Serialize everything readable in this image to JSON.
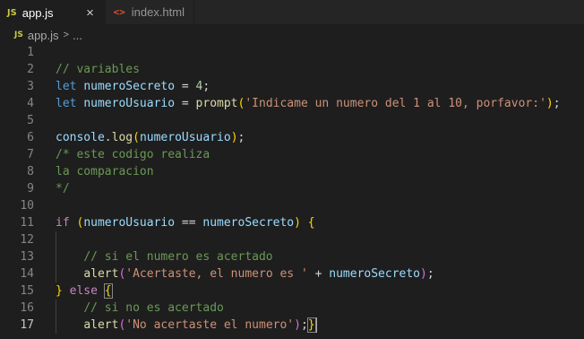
{
  "tabs": [
    {
      "icon": "JS",
      "label": "app.js",
      "active": true,
      "close": "×"
    },
    {
      "icon": "<>",
      "label": "index.html",
      "active": false
    }
  ],
  "breadcrumb": {
    "icon": "JS",
    "file": "app.js",
    "separator": ">",
    "more": "..."
  },
  "editor": {
    "current_line": 17,
    "line_numbers": [
      "1",
      "2",
      "3",
      "4",
      "5",
      "6",
      "7",
      "8",
      "9",
      "10",
      "11",
      "12",
      "13",
      "14",
      "15",
      "16",
      "17"
    ],
    "lines": [
      {
        "tokens": []
      },
      {
        "tokens": [
          {
            "t": "// variables",
            "c": "cm"
          }
        ]
      },
      {
        "tokens": [
          {
            "t": "let",
            "c": "kw"
          },
          {
            "t": " ",
            "c": "op"
          },
          {
            "t": "numeroSecreto",
            "c": "var"
          },
          {
            "t": " = ",
            "c": "op"
          },
          {
            "t": "4",
            "c": "num"
          },
          {
            "t": ";",
            "c": "op"
          }
        ]
      },
      {
        "tokens": [
          {
            "t": "let",
            "c": "kw"
          },
          {
            "t": " ",
            "c": "op"
          },
          {
            "t": "numeroUsuario",
            "c": "var"
          },
          {
            "t": " = ",
            "c": "op"
          },
          {
            "t": "prompt",
            "c": "fn"
          },
          {
            "t": "(",
            "c": "p1"
          },
          {
            "t": "'Indicame un numero del 1 al 10, porfavor:'",
            "c": "str"
          },
          {
            "t": ")",
            "c": "p1"
          },
          {
            "t": ";",
            "c": "op"
          }
        ]
      },
      {
        "tokens": []
      },
      {
        "tokens": [
          {
            "t": "console",
            "c": "var"
          },
          {
            "t": ".",
            "c": "op"
          },
          {
            "t": "log",
            "c": "fn"
          },
          {
            "t": "(",
            "c": "p1"
          },
          {
            "t": "numeroUsuario",
            "c": "var"
          },
          {
            "t": ")",
            "c": "p1"
          },
          {
            "t": ";",
            "c": "op"
          }
        ]
      },
      {
        "tokens": [
          {
            "t": "/* este codigo realiza",
            "c": "cm"
          }
        ]
      },
      {
        "tokens": [
          {
            "t": "la comparacion",
            "c": "cm"
          }
        ]
      },
      {
        "tokens": [
          {
            "t": "*/",
            "c": "cm"
          }
        ]
      },
      {
        "tokens": []
      },
      {
        "tokens": [
          {
            "t": "if",
            "c": "ctl"
          },
          {
            "t": " ",
            "c": "op"
          },
          {
            "t": "(",
            "c": "p1"
          },
          {
            "t": "numeroUsuario",
            "c": "var"
          },
          {
            "t": " == ",
            "c": "op"
          },
          {
            "t": "numeroSecreto",
            "c": "var"
          },
          {
            "t": ")",
            "c": "p1"
          },
          {
            "t": " ",
            "c": "op"
          },
          {
            "t": "{",
            "c": "p1"
          }
        ]
      },
      {
        "tokens": []
      },
      {
        "tokens": [
          {
            "t": "    ",
            "c": "op"
          },
          {
            "t": "// si el numero es acertado",
            "c": "cm"
          }
        ]
      },
      {
        "tokens": [
          {
            "t": "    ",
            "c": "op"
          },
          {
            "t": "alert",
            "c": "fn"
          },
          {
            "t": "(",
            "c": "p2"
          },
          {
            "t": "'Acertaste, el numero es '",
            "c": "str"
          },
          {
            "t": " + ",
            "c": "op"
          },
          {
            "t": "numeroSecreto",
            "c": "var"
          },
          {
            "t": ")",
            "c": "p2"
          },
          {
            "t": ";",
            "c": "op"
          }
        ]
      },
      {
        "tokens": [
          {
            "t": "}",
            "c": "p1"
          },
          {
            "t": " ",
            "c": "op"
          },
          {
            "t": "else",
            "c": "ctl"
          },
          {
            "t": " ",
            "c": "op"
          },
          {
            "t": "{",
            "c": "p1",
            "m": true
          }
        ]
      },
      {
        "tokens": [
          {
            "t": "    ",
            "c": "op"
          },
          {
            "t": "// si no es acertado",
            "c": "cm"
          }
        ]
      },
      {
        "tokens": [
          {
            "t": "    ",
            "c": "op"
          },
          {
            "t": "alert",
            "c": "fn"
          },
          {
            "t": "(",
            "c": "p2"
          },
          {
            "t": "'No acertaste el numero'",
            "c": "str"
          },
          {
            "t": ")",
            "c": "p2"
          },
          {
            "t": ";",
            "c": "op"
          },
          {
            "t": "}",
            "c": "p1",
            "m": true,
            "cursor": true
          }
        ]
      }
    ]
  },
  "colors": {
    "background": "#1e1e1e",
    "tabbar": "#252526",
    "keyword": "#569cd6",
    "control": "#c586c0",
    "variable": "#9cdcfe",
    "function": "#dcdcaa",
    "string": "#ce9178",
    "number": "#b5cea8",
    "comment": "#6a9955"
  }
}
